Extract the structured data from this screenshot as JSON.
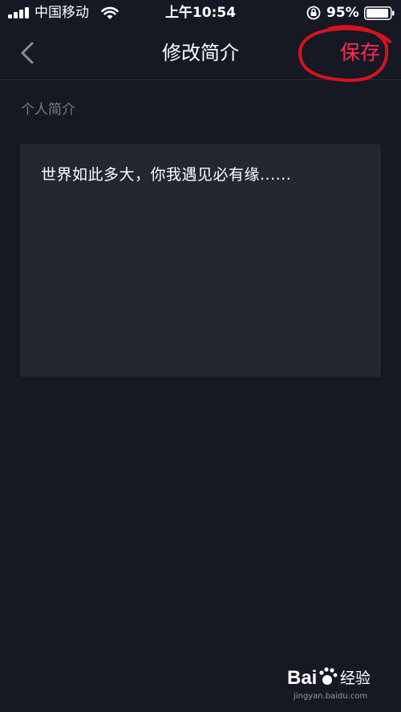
{
  "status_bar": {
    "carrier": "中国移动",
    "time": "上午10:54",
    "battery_percent": "95%",
    "battery_level": 0.95,
    "icons": [
      "signal-icon",
      "wifi-icon",
      "orientation-lock-icon",
      "battery-icon"
    ]
  },
  "nav": {
    "title": "修改简介",
    "save_label": "保存",
    "back_icon": "chevron-left-icon"
  },
  "bio": {
    "section_label": "个人简介",
    "text": "世界如此多大，你我遇见必有缘......"
  },
  "watermark": {
    "logo_text": "Bai 经验",
    "url": "jingyan.baidu.com"
  },
  "colors": {
    "background": "#161823",
    "accent": "#fe2c55",
    "box": "#252730",
    "annotation": "#d4141e"
  }
}
